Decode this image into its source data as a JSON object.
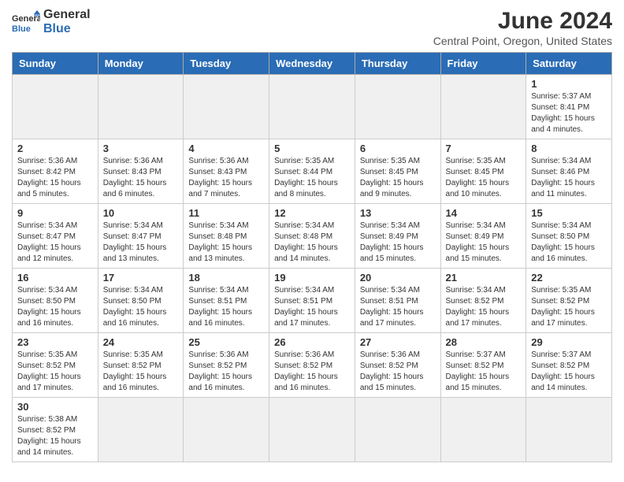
{
  "logo": {
    "text_general": "General",
    "text_blue": "Blue"
  },
  "title": "June 2024",
  "subtitle": "Central Point, Oregon, United States",
  "days_of_week": [
    "Sunday",
    "Monday",
    "Tuesday",
    "Wednesday",
    "Thursday",
    "Friday",
    "Saturday"
  ],
  "weeks": [
    [
      {
        "day": "",
        "empty": true
      },
      {
        "day": "",
        "empty": true
      },
      {
        "day": "",
        "empty": true
      },
      {
        "day": "",
        "empty": true
      },
      {
        "day": "",
        "empty": true
      },
      {
        "day": "",
        "empty": true
      },
      {
        "day": "1",
        "info": "Sunrise: 5:37 AM\nSunset: 8:41 PM\nDaylight: 15 hours\nand 4 minutes."
      }
    ],
    [
      {
        "day": "2",
        "info": "Sunrise: 5:36 AM\nSunset: 8:42 PM\nDaylight: 15 hours\nand 5 minutes."
      },
      {
        "day": "3",
        "info": "Sunrise: 5:36 AM\nSunset: 8:43 PM\nDaylight: 15 hours\nand 6 minutes."
      },
      {
        "day": "4",
        "info": "Sunrise: 5:36 AM\nSunset: 8:43 PM\nDaylight: 15 hours\nand 7 minutes."
      },
      {
        "day": "5",
        "info": "Sunrise: 5:35 AM\nSunset: 8:44 PM\nDaylight: 15 hours\nand 8 minutes."
      },
      {
        "day": "6",
        "info": "Sunrise: 5:35 AM\nSunset: 8:45 PM\nDaylight: 15 hours\nand 9 minutes."
      },
      {
        "day": "7",
        "info": "Sunrise: 5:35 AM\nSunset: 8:45 PM\nDaylight: 15 hours\nand 10 minutes."
      },
      {
        "day": "8",
        "info": "Sunrise: 5:34 AM\nSunset: 8:46 PM\nDaylight: 15 hours\nand 11 minutes."
      }
    ],
    [
      {
        "day": "9",
        "info": "Sunrise: 5:34 AM\nSunset: 8:47 PM\nDaylight: 15 hours\nand 12 minutes."
      },
      {
        "day": "10",
        "info": "Sunrise: 5:34 AM\nSunset: 8:47 PM\nDaylight: 15 hours\nand 13 minutes."
      },
      {
        "day": "11",
        "info": "Sunrise: 5:34 AM\nSunset: 8:48 PM\nDaylight: 15 hours\nand 13 minutes."
      },
      {
        "day": "12",
        "info": "Sunrise: 5:34 AM\nSunset: 8:48 PM\nDaylight: 15 hours\nand 14 minutes."
      },
      {
        "day": "13",
        "info": "Sunrise: 5:34 AM\nSunset: 8:49 PM\nDaylight: 15 hours\nand 15 minutes."
      },
      {
        "day": "14",
        "info": "Sunrise: 5:34 AM\nSunset: 8:49 PM\nDaylight: 15 hours\nand 15 minutes."
      },
      {
        "day": "15",
        "info": "Sunrise: 5:34 AM\nSunset: 8:50 PM\nDaylight: 15 hours\nand 16 minutes."
      }
    ],
    [
      {
        "day": "16",
        "info": "Sunrise: 5:34 AM\nSunset: 8:50 PM\nDaylight: 15 hours\nand 16 minutes."
      },
      {
        "day": "17",
        "info": "Sunrise: 5:34 AM\nSunset: 8:50 PM\nDaylight: 15 hours\nand 16 minutes."
      },
      {
        "day": "18",
        "info": "Sunrise: 5:34 AM\nSunset: 8:51 PM\nDaylight: 15 hours\nand 16 minutes."
      },
      {
        "day": "19",
        "info": "Sunrise: 5:34 AM\nSunset: 8:51 PM\nDaylight: 15 hours\nand 17 minutes."
      },
      {
        "day": "20",
        "info": "Sunrise: 5:34 AM\nSunset: 8:51 PM\nDaylight: 15 hours\nand 17 minutes."
      },
      {
        "day": "21",
        "info": "Sunrise: 5:34 AM\nSunset: 8:52 PM\nDaylight: 15 hours\nand 17 minutes."
      },
      {
        "day": "22",
        "info": "Sunrise: 5:35 AM\nSunset: 8:52 PM\nDaylight: 15 hours\nand 17 minutes."
      }
    ],
    [
      {
        "day": "23",
        "info": "Sunrise: 5:35 AM\nSunset: 8:52 PM\nDaylight: 15 hours\nand 17 minutes."
      },
      {
        "day": "24",
        "info": "Sunrise: 5:35 AM\nSunset: 8:52 PM\nDaylight: 15 hours\nand 16 minutes."
      },
      {
        "day": "25",
        "info": "Sunrise: 5:36 AM\nSunset: 8:52 PM\nDaylight: 15 hours\nand 16 minutes."
      },
      {
        "day": "26",
        "info": "Sunrise: 5:36 AM\nSunset: 8:52 PM\nDaylight: 15 hours\nand 16 minutes."
      },
      {
        "day": "27",
        "info": "Sunrise: 5:36 AM\nSunset: 8:52 PM\nDaylight: 15 hours\nand 15 minutes."
      },
      {
        "day": "28",
        "info": "Sunrise: 5:37 AM\nSunset: 8:52 PM\nDaylight: 15 hours\nand 15 minutes."
      },
      {
        "day": "29",
        "info": "Sunrise: 5:37 AM\nSunset: 8:52 PM\nDaylight: 15 hours\nand 14 minutes."
      }
    ],
    [
      {
        "day": "30",
        "info": "Sunrise: 5:38 AM\nSunset: 8:52 PM\nDaylight: 15 hours\nand 14 minutes."
      },
      {
        "day": "",
        "empty": true
      },
      {
        "day": "",
        "empty": true
      },
      {
        "day": "",
        "empty": true
      },
      {
        "day": "",
        "empty": true
      },
      {
        "day": "",
        "empty": true
      },
      {
        "day": "",
        "empty": true
      }
    ]
  ]
}
